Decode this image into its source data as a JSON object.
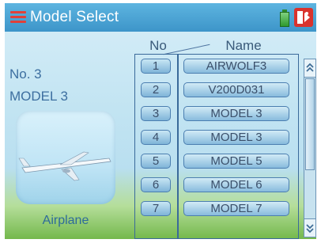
{
  "title": "Model Select",
  "columns": {
    "no": "No",
    "name": "Name"
  },
  "selected": {
    "number": "No. 3",
    "name": "MODEL 3",
    "type": "Airplane"
  },
  "models": [
    {
      "no": "1",
      "name": "AIRWOLF3"
    },
    {
      "no": "2",
      "name": "V200D031"
    },
    {
      "no": "3",
      "name": "MODEL 3"
    },
    {
      "no": "4",
      "name": "MODEL 3"
    },
    {
      "no": "5",
      "name": "MODEL 5"
    },
    {
      "no": "6",
      "name": "MODEL 6"
    },
    {
      "no": "7",
      "name": "MODEL 7"
    }
  ],
  "icons": {
    "menu": "menu-icon",
    "battery": "battery-icon",
    "exit": "exit-icon",
    "scroll_up": "double-chevron-up-icon",
    "scroll_down": "double-chevron-down-icon"
  },
  "colors": {
    "title_bar": "#3d95c9",
    "exit_button": "#d9332d",
    "battery": "#2f9a2f",
    "cell_border": "#4b7eb0"
  }
}
